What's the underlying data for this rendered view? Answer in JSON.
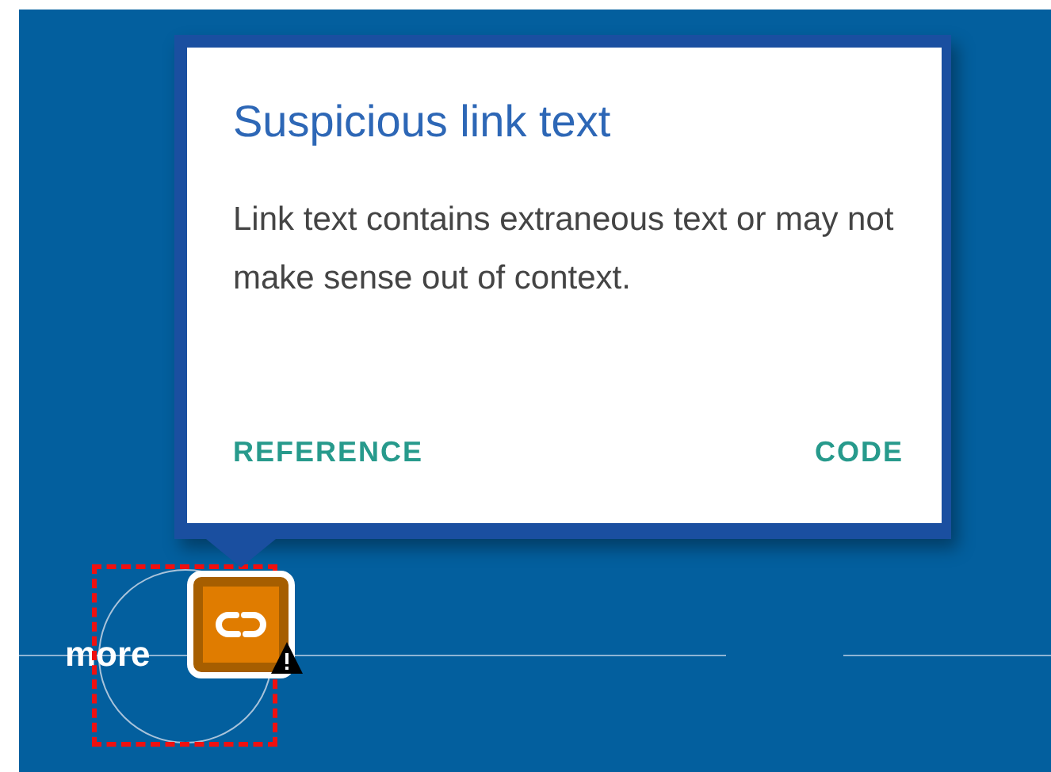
{
  "popup": {
    "title": "Suspicious link text",
    "description": "Link text contains extraneous text or may not make sense out of context.",
    "actions": [
      {
        "label": "REFERENCE"
      },
      {
        "label": "CODE"
      }
    ]
  },
  "element": {
    "label": "more",
    "highlighted": true
  }
}
